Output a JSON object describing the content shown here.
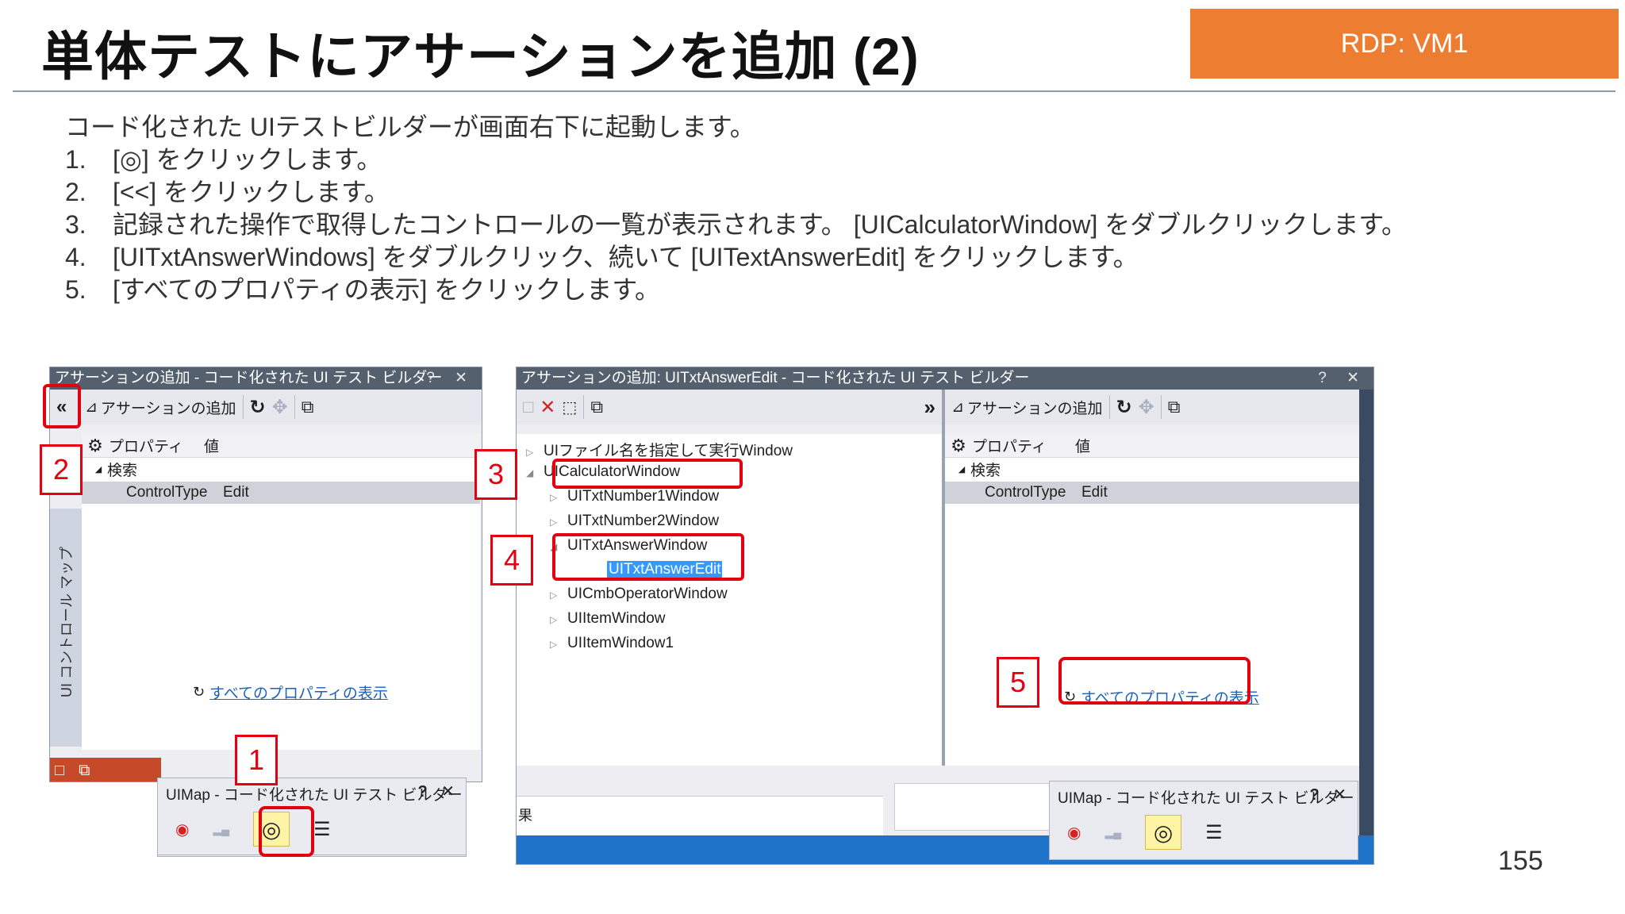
{
  "title": "単体テストにアサーションを追加 (2)",
  "badge": "RDP: VM1",
  "intro": "コード化された UIテストビルダーが画面右下に起動します。",
  "steps": [
    {
      "num": "1.",
      "text": "[◎] をクリックします。"
    },
    {
      "num": "2.",
      "text": "[<<] をクリックします。"
    },
    {
      "num": "3.",
      "text": "記録された操作で取得したコントロールの一覧が表示されます。 [UICalculatorWindow] をダブルクリックします。"
    },
    {
      "num": "4.",
      "text": "[UITxtAnswerWindows] をダブルクリック、続いて [UITextAnswerEdit] をクリックします。"
    },
    {
      "num": "5.",
      "text": "[すべてのプロパティの表示] をクリックします。"
    }
  ],
  "page_number": "155",
  "left_panel": {
    "title": "アサーションの追加 - コード化された UI テスト ビルダー",
    "title_buttons": "? ✕",
    "collapse": "«",
    "add_assertion": "アサーションの追加",
    "col_property": "プロパティ",
    "col_value": "値",
    "group": "検索",
    "row_name": "ControlType",
    "row_value": "Edit",
    "side_label": "UI コントロール マップ",
    "show_all": "すべてのプロパティの表示"
  },
  "left_mini": {
    "title": "UIMap - コード化された UI テスト ビルダー",
    "buttons": "? ✕"
  },
  "right_panel": {
    "title": "アサーションの追加: UITxtAnswerEdit - コード化された UI テスト ビルダー",
    "title_buttons": "? ✕",
    "expand": "»",
    "add_assertion": "アサーションの追加",
    "col_property": "プロパティ",
    "col_value": "値",
    "group": "検索",
    "row_name": "ControlType",
    "row_value": "Edit",
    "show_all": "すべてのプロパティの表示",
    "bottom_text": "果",
    "tree": [
      "UIファイル名を指定して実行Window",
      "UICalculatorWindow",
      "UITxtNumber1Window",
      "UITxtNumber2Window",
      "UITxtAnswerWindow",
      "UITxtAnswerEdit",
      "UICmbOperatorWindow",
      "UIItemWindow",
      "UIItemWindow1"
    ]
  },
  "right_mini": {
    "title": "UIMap - コード化された UI テスト ビルダー",
    "buttons": "? ✕"
  },
  "callouts": [
    "1",
    "2",
    "3",
    "4",
    "5"
  ],
  "icons": {
    "gear": "⚙",
    "refresh": "↻",
    "move": "✥",
    "copy": "⧉",
    "assert": "⊿",
    "record": "◉",
    "crosshair": "◎",
    "bars": "▂▄",
    "list": "☰",
    "close_x": "✕",
    "select": "⬚",
    "new": "□",
    "tree_collapsed": "▷",
    "tree_expanded": "◢"
  }
}
